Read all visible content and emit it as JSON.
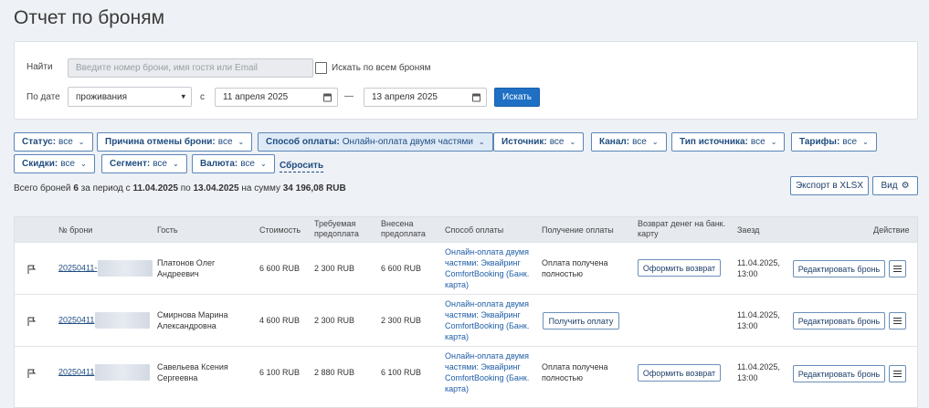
{
  "page_title": "Отчет по броням",
  "search": {
    "find_label": "Найти",
    "find_placeholder": "Введите номер брони, имя гостя или Email",
    "search_all_label": "Искать по всем броням",
    "by_date_label": "По дате",
    "date_type_value": "проживания",
    "from_label": "с",
    "date_from": "11 апреля 2025",
    "dash": "—",
    "date_to": "13 апреля 2025",
    "search_button": "Искать"
  },
  "filters": [
    {
      "label": "Статус:",
      "value": "все"
    },
    {
      "label": "Причина отмены брони:",
      "value": "все"
    },
    {
      "label": "Способ оплаты:",
      "value": "Онлайн-оплата двумя частями",
      "active": true
    },
    {
      "label": "Источник:",
      "value": "все"
    },
    {
      "label": "Канал:",
      "value": "все"
    },
    {
      "label": "Тип источника:",
      "value": "все"
    },
    {
      "label": "Тарифы:",
      "value": "все"
    },
    {
      "label": "Скидки:",
      "value": "все"
    },
    {
      "label": "Сегмент:",
      "value": "все"
    },
    {
      "label": "Валюта:",
      "value": "все"
    }
  ],
  "reset_label": "Сбросить",
  "summary": {
    "prefix": "Всего броней",
    "count": "6",
    "period_text": "за период с",
    "from": "11.04.2025",
    "to_text": "по",
    "to": "13.04.2025",
    "sum_text": "на сумму",
    "sum": "34 196,08 RUB"
  },
  "export_button": "Экспорт в XLSX",
  "view_button": "Вид",
  "columns": {
    "booking_no": "№ брони",
    "guest": "Гость",
    "cost": "Стоимость",
    "required_prepay": "Требуемая предоплата",
    "paid_prepay": "Внесена предоплата",
    "payment_method": "Способ оплаты",
    "payment_receipt": "Получение оплаты",
    "refund": "Возврат денег на банк. карту",
    "checkin": "Заезд",
    "action": "Действие"
  },
  "rows": [
    {
      "booking_no": "20250411-",
      "guest": "Платонов Олег Андреевич",
      "cost": "6 600 RUB",
      "required_prepay": "2 300 RUB",
      "paid_prepay": "6 600 RUB",
      "payment_method": "Онлайн-оплата двумя частями: Эквайринг ComfortBooking (Банк. карта)",
      "payment_receipt": "Оплата получена полностью",
      "refund_button": "Оформить возврат",
      "checkin": "11.04.2025, 13:00",
      "edit_button": "Редактировать бронь"
    },
    {
      "booking_no": "20250411",
      "guest": "Смирнова Марина Александровна",
      "cost": "4 600 RUB",
      "required_prepay": "2 300 RUB",
      "paid_prepay": "2 300 RUB",
      "payment_method": "Онлайн-оплата двумя частями: Эквайринг ComfortBooking (Банк. карта)",
      "payment_receipt_button": "Получить оплату",
      "checkin": "11.04.2025, 13:00",
      "edit_button": "Редактировать бронь"
    },
    {
      "booking_no": "20250411",
      "guest": "Савельева Ксения Сергеевна",
      "cost": "6 100 RUB",
      "required_prepay": "2 880 RUB",
      "paid_prepay": "6 100 RUB",
      "payment_method": "Онлайн-оплата двумя частями: Эквайринг ComfortBooking (Банк. карта)",
      "payment_receipt": "Оплата получена полностью",
      "refund_button": "Оформить возврат",
      "checkin": "11.04.2025, 13:00",
      "edit_button": "Редактировать бронь"
    }
  ],
  "colors": {
    "primary": "#1f6fc5",
    "link": "#1f5ea8",
    "filter_border": "#5a86b8"
  }
}
